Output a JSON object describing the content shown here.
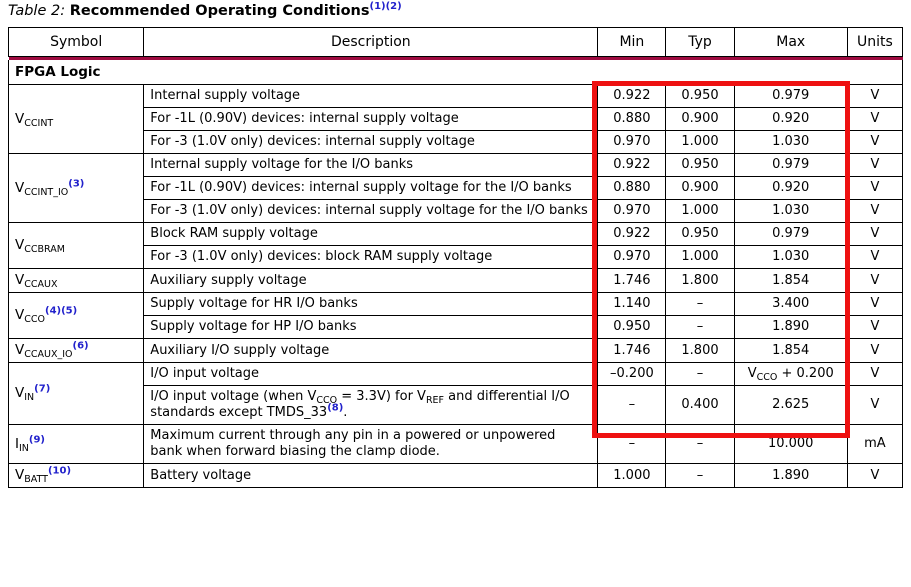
{
  "caption": {
    "label": "Table",
    "number": "2:",
    "title": "Recommended Operating Conditions",
    "footnotes": "(1)(2)"
  },
  "table": {
    "columns": [
      "Symbol",
      "Description",
      "Min",
      "Typ",
      "Max",
      "Units"
    ],
    "section_label": "FPGA Logic",
    "rows": [
      {
        "symbol_base": "V",
        "symbol_sub": "CCINT",
        "symbol_sup": "",
        "description": "Internal supply voltage",
        "min": "0.922",
        "typ": "0.950",
        "max": "0.979",
        "units": "V"
      },
      {
        "symbol_base": "",
        "symbol_sub": "",
        "symbol_sup": "",
        "description": "For -1L (0.90V) devices: internal supply voltage",
        "min": "0.880",
        "typ": "0.900",
        "max": "0.920",
        "units": "V"
      },
      {
        "symbol_base": "",
        "symbol_sub": "",
        "symbol_sup": "",
        "description": "For -3 (1.0V only) devices: internal supply voltage",
        "min": "0.970",
        "typ": "1.000",
        "max": "1.030",
        "units": "V"
      },
      {
        "symbol_base": "V",
        "symbol_sub": "CCINT_IO",
        "symbol_sup": "(3)",
        "description": "Internal supply voltage for the I/O banks",
        "min": "0.922",
        "typ": "0.950",
        "max": "0.979",
        "units": "V"
      },
      {
        "symbol_base": "",
        "symbol_sub": "",
        "symbol_sup": "",
        "description": "For -1L (0.90V) devices: internal supply voltage for the I/O banks",
        "min": "0.880",
        "typ": "0.900",
        "max": "0.920",
        "units": "V"
      },
      {
        "symbol_base": "",
        "symbol_sub": "",
        "symbol_sup": "",
        "description": "For -3 (1.0V only) devices: internal supply voltage for the I/O banks",
        "min": "0.970",
        "typ": "1.000",
        "max": "1.030",
        "units": "V"
      },
      {
        "symbol_base": "V",
        "symbol_sub": "CCBRAM",
        "symbol_sup": "",
        "description": "Block RAM supply voltage",
        "min": "0.922",
        "typ": "0.950",
        "max": "0.979",
        "units": "V"
      },
      {
        "symbol_base": "",
        "symbol_sub": "",
        "symbol_sup": "",
        "description": "For -3 (1.0V only) devices: block RAM supply voltage",
        "min": "0.970",
        "typ": "1.000",
        "max": "1.030",
        "units": "V"
      },
      {
        "symbol_base": "V",
        "symbol_sub": "CCAUX",
        "symbol_sup": "",
        "description": "Auxiliary supply voltage",
        "min": "1.746",
        "typ": "1.800",
        "max": "1.854",
        "units": "V"
      },
      {
        "symbol_base": "V",
        "symbol_sub": "CCO",
        "symbol_sup": "(4)(5)",
        "description": "Supply voltage for HR I/O banks",
        "min": "1.140",
        "typ": "–",
        "max": "3.400",
        "units": "V"
      },
      {
        "symbol_base": "",
        "symbol_sub": "",
        "symbol_sup": "",
        "description": "Supply voltage for HP I/O banks",
        "min": "0.950",
        "typ": "–",
        "max": "1.890",
        "units": "V"
      },
      {
        "symbol_base": "V",
        "symbol_sub": "CCAUX_IO",
        "symbol_sup": "(6)",
        "description": "Auxiliary I/O supply voltage",
        "min": "1.746",
        "typ": "1.800",
        "max": "1.854",
        "units": "V"
      },
      {
        "symbol_base": "V",
        "symbol_sub": "IN",
        "symbol_sup": "(7)",
        "description": "I/O input voltage",
        "min": "–0.200",
        "typ": "–",
        "max": "V_CCO + 0.200",
        "units": "V"
      },
      {
        "symbol_base": "",
        "symbol_sub": "",
        "symbol_sup": "",
        "description": "I/O input voltage (when V_CCO = 3.3V) for V_REF and differential I/O standards except TMDS_33(8).",
        "min": "–",
        "typ": "0.400",
        "max": "2.625",
        "units": "V"
      },
      {
        "symbol_base": "I",
        "symbol_sub": "IN",
        "symbol_sup": "(9)",
        "description": "Maximum current through any pin in a powered or unpowered bank when forward biasing the clamp diode.",
        "min": "–",
        "typ": "–",
        "max": "10.000",
        "units": "mA"
      },
      {
        "symbol_base": "V",
        "symbol_sub": "BATT",
        "symbol_sup": "(10)",
        "description": "Battery voltage",
        "min": "1.000",
        "typ": "–",
        "max": "1.890",
        "units": "V"
      }
    ]
  },
  "annotations": {
    "highlight_box_color": "#ee1111",
    "header_rule_color": "#9e0b40",
    "footnote_color": "#2222cc"
  },
  "composed": {
    "row13_max_pre": "V",
    "row13_max_sub": "CCO",
    "row13_max_post": " + 0.200",
    "row14_desc_p1": "I/O input voltage (when V",
    "row14_desc_s1": "CCO",
    "row14_desc_p2": " = 3.3V) for V",
    "row14_desc_s2": "REF",
    "row14_desc_p3": " and differential I/O standards except TMDS_33",
    "row14_desc_sup": "(8)",
    "row14_desc_p4": "."
  }
}
